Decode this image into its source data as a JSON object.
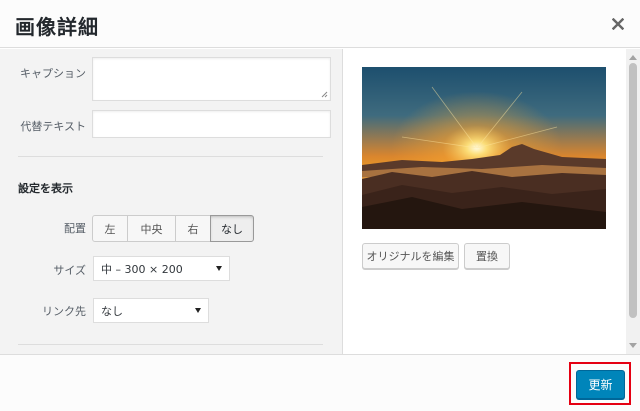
{
  "header": {
    "title": "画像詳細"
  },
  "form": {
    "caption_label": "キャプション",
    "caption_value": "",
    "alt_label": "代替テキスト",
    "alt_value": "",
    "section_title": "設定を表示",
    "align_label": "配置",
    "align_options": [
      "左",
      "中央",
      "右",
      "なし"
    ],
    "align_selected": "なし",
    "size_label": "サイズ",
    "size_value": "中 – 300 × 200",
    "link_label": "リンク先",
    "link_value": "なし"
  },
  "preview": {
    "edit_original_label": "オリジナルを編集",
    "replace_label": "置換"
  },
  "footer": {
    "update_label": "更新"
  },
  "colors": {
    "primary": "#0085ba",
    "highlight": "#e50012"
  }
}
